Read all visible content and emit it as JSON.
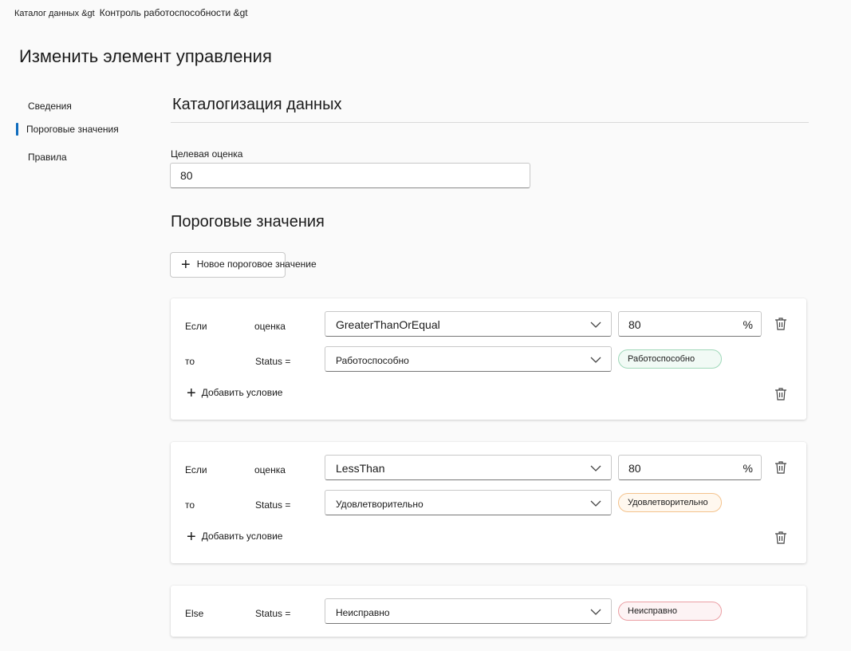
{
  "breadcrumb": {
    "item1": "Каталог данных &gt",
    "item2": "Контроль работоспособности &gt"
  },
  "page_title": "Изменить элемент управления",
  "nav": {
    "items": [
      "Сведения",
      "Пороговые значения",
      "Правила"
    ]
  },
  "section": {
    "title": "Каталогизация данных",
    "target_label": "Целевая оценка",
    "target_value": "80"
  },
  "thresholds": {
    "title": "Пороговые значения",
    "new_button": "Новое пороговое значение",
    "add_condition": "Добавить условие",
    "if_label": "Если",
    "score_label": "оценка",
    "then_label": "то",
    "status_label": "Status =",
    "percent": "%",
    "rules": [
      {
        "operator": "GreaterThanOrEqual",
        "value": "80",
        "status": "Работоспособно",
        "badge": "Работоспособно"
      },
      {
        "operator": "LessThan",
        "value": "80",
        "status": "Удовлетворительно",
        "badge": "Удовлетворительно"
      }
    ],
    "else": {
      "label": "Else",
      "status": "Неисправно",
      "badge": "Неисправно"
    }
  },
  "colors": {
    "accent": "#0f6cbd",
    "healthy": "#9fd8b9",
    "fair": "#f4c28c",
    "unhealthy": "#eba0a5"
  },
  "icons": {
    "plus": "plus-icon",
    "chevron": "chevron-down-icon",
    "trash": "trash-icon"
  }
}
